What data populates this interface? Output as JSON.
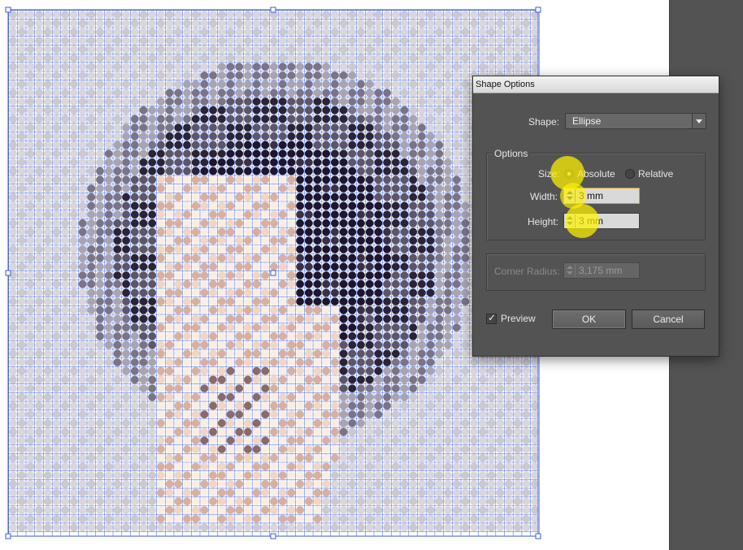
{
  "dialog": {
    "title": "Shape Options",
    "shape_label": "Shape:",
    "shape_value": "Ellipse",
    "options_group_label": "Options",
    "size_label": "Size:",
    "size_options": [
      {
        "label": "Absolute",
        "selected": true
      },
      {
        "label": "Relative",
        "selected": false
      }
    ],
    "width_label": "Width:",
    "width_value": "3 mm",
    "height_label": "Height:",
    "height_value": "3 mm",
    "corner_radius_label": "Corner Radius:",
    "corner_radius_value": "3,175 mm",
    "preview_label": "Preview",
    "preview_checked": true,
    "ok_label": "OK",
    "cancel_label": "Cancel"
  },
  "colors": {
    "dialog_bg": "#535353",
    "selection_blue": "#3a5bd8",
    "highlight_yellow": "#fff200",
    "focus_orange": "#e3961e"
  },
  "canvas": {
    "content": "pixelated halftone portrait made of colored ellipses with blue selection guides"
  }
}
